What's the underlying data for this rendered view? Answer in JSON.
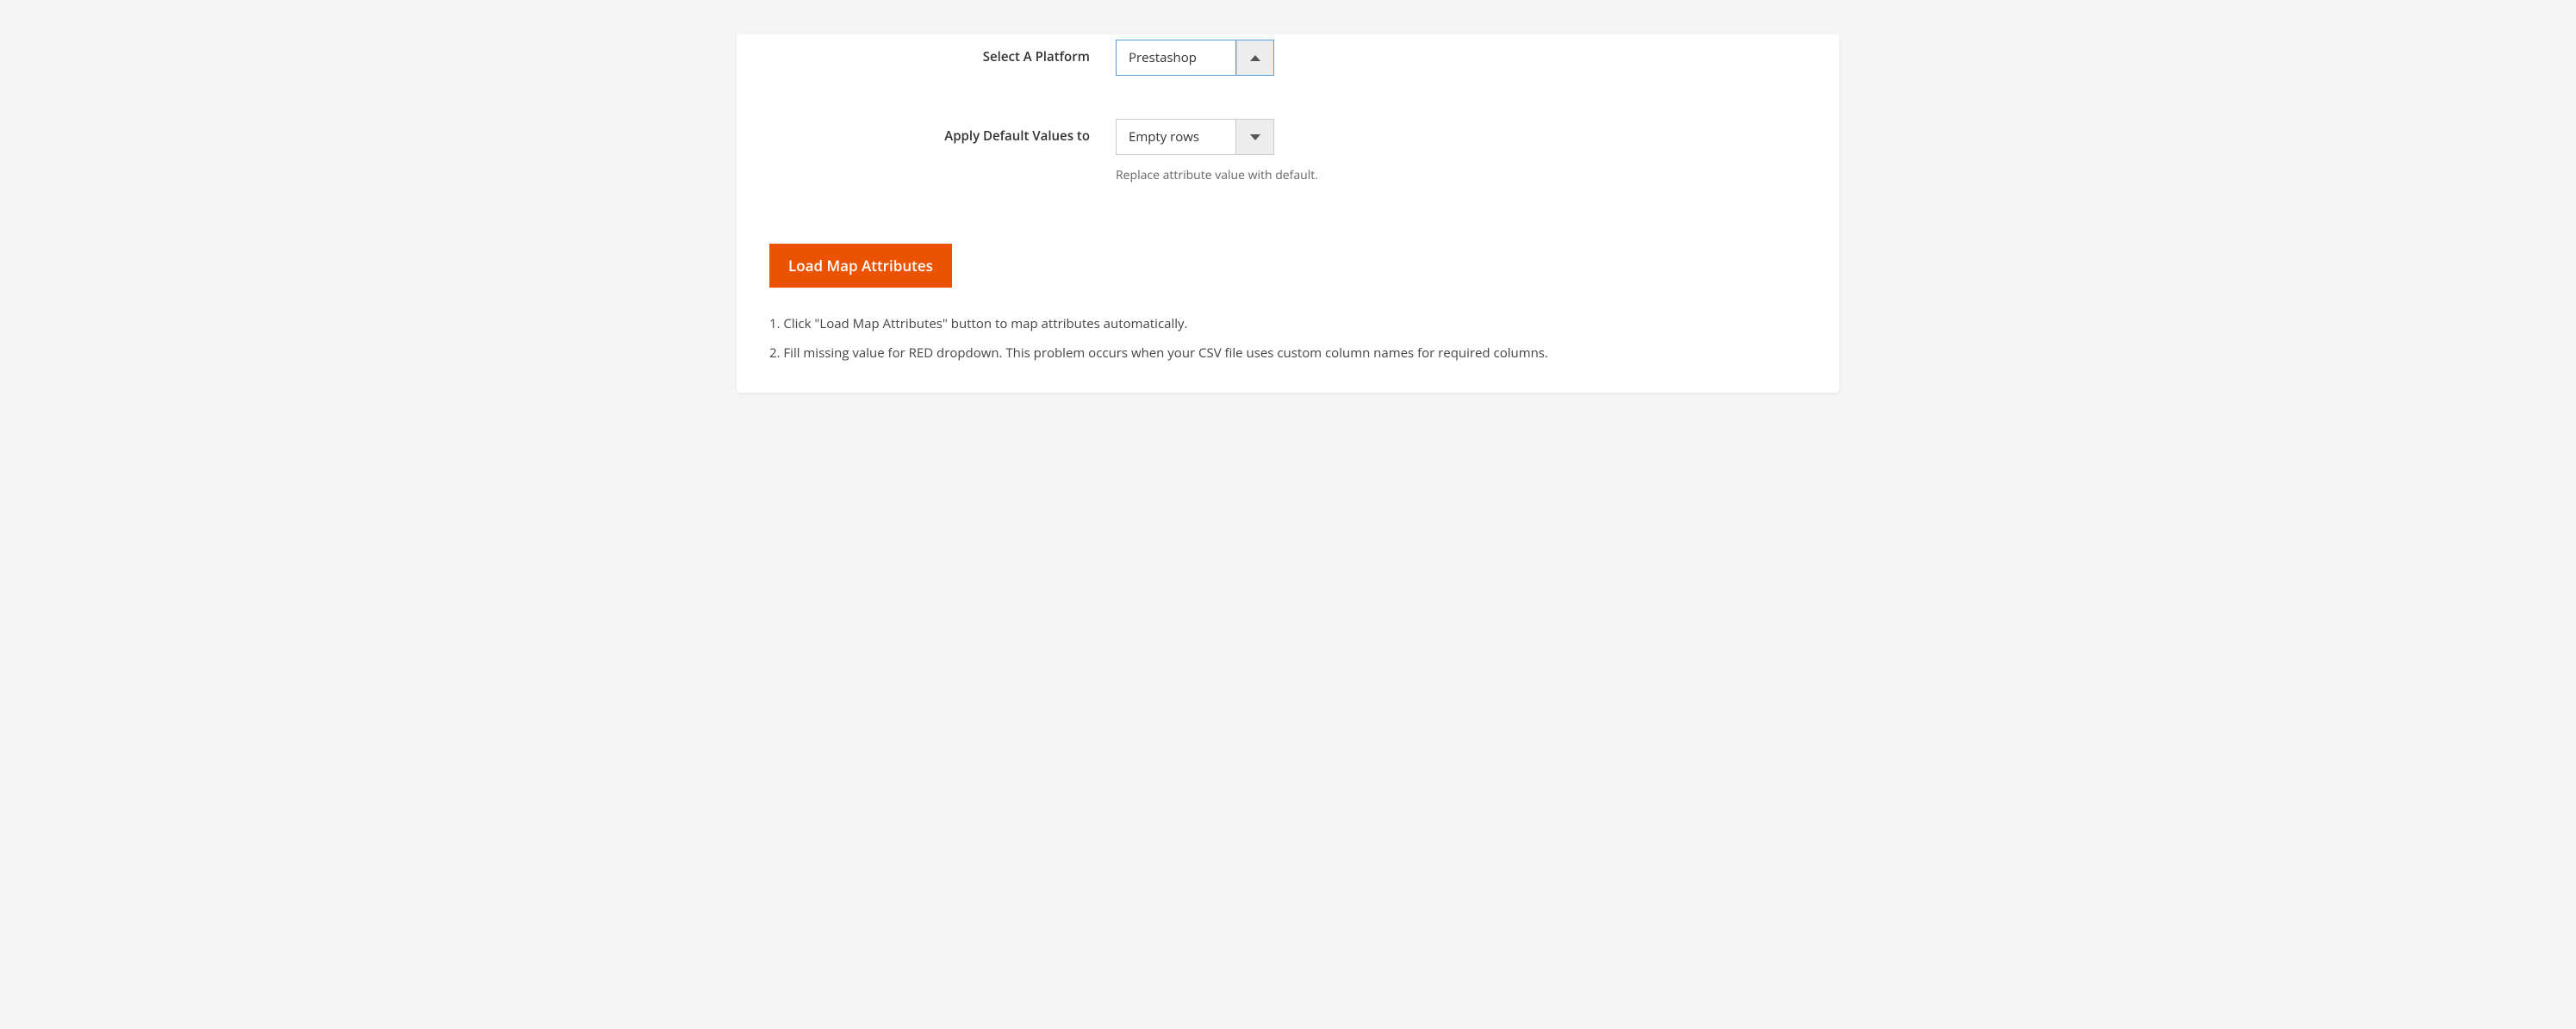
{
  "form": {
    "platform": {
      "label": "Select A Platform",
      "value": "Prestashop"
    },
    "defaults": {
      "label": "Apply Default Values to",
      "value": "Empty rows",
      "help": "Replace attribute value with default."
    }
  },
  "button": {
    "load_map": "Load Map Attributes"
  },
  "instructions": {
    "line1": "1. Click \"Load Map Attributes\" button to map attributes automatically.",
    "line2": "2. Fill missing value for RED dropdown. This problem occurs when your CSV file uses custom column names for required columns."
  }
}
